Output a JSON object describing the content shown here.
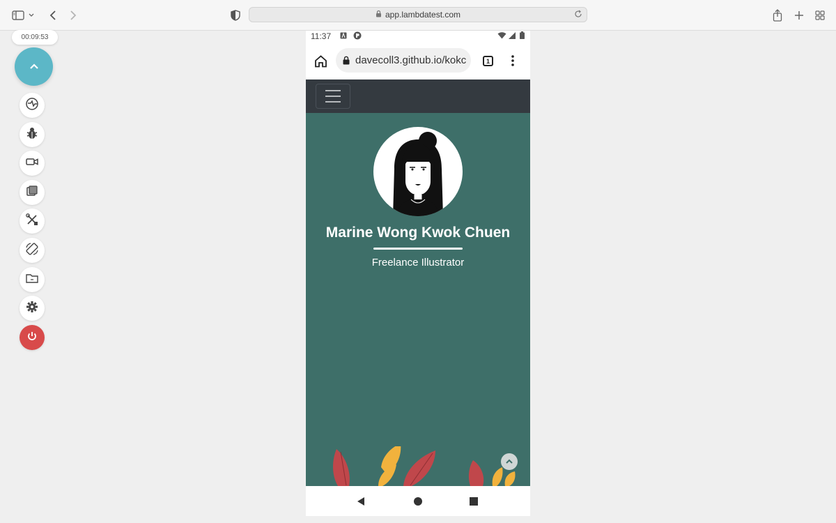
{
  "browser": {
    "url": "app.lambdatest.com"
  },
  "session": {
    "timer": "00:09:53"
  },
  "device": {
    "status_time": "11:37",
    "address_text": "davecoll3.github.io/kokc",
    "tab_count": "1"
  },
  "site": {
    "name": "Marine Wong Kwok Chuen",
    "role": "Freelance Illustrator"
  },
  "colors": {
    "masthead": "#3e6f69",
    "nav": "#343a40",
    "accent_button": "#5cb7c7",
    "power_button": "#d84a4a"
  },
  "icons": [
    "sidebar-icon",
    "back-icon",
    "forward-icon",
    "shield-icon",
    "lock-icon",
    "reload-icon",
    "share-icon",
    "plus-icon",
    "tabs-grid-icon",
    "chevron-up-icon",
    "switch-icon",
    "bug-icon",
    "camera-icon",
    "screenshot-icon",
    "tools-icon",
    "rotate-icon",
    "folder-icon",
    "gear-icon",
    "power-icon",
    "home-icon",
    "more-icon"
  ]
}
